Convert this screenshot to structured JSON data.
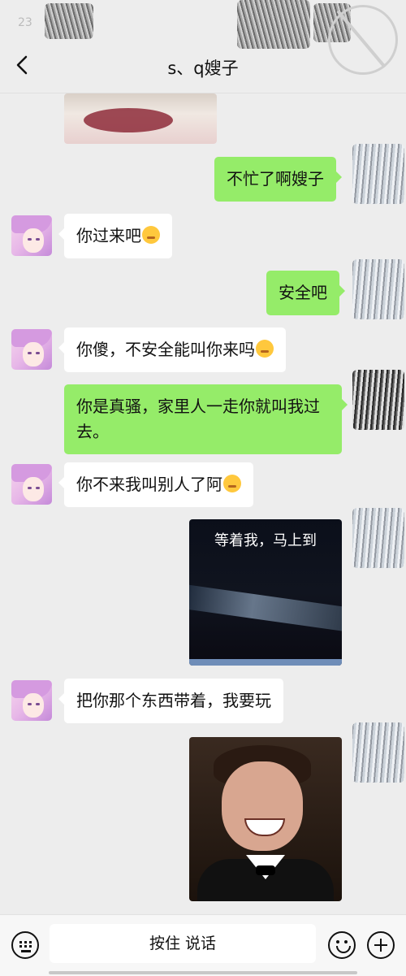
{
  "status": {
    "time": "23"
  },
  "header": {
    "title": "s、q嫂子",
    "back_icon": "chevron-left-icon"
  },
  "messages": [
    {
      "side": "out",
      "text": "不忙了啊嫂子"
    },
    {
      "side": "in",
      "text": "你过来吧"
    },
    {
      "side": "out",
      "text": "安全吧"
    },
    {
      "side": "in",
      "text": "你傻，不安全能叫你来吗"
    },
    {
      "side": "out",
      "text": "你是真骚，家里人一走你就叫我过去。"
    },
    {
      "side": "in",
      "text": "你不来我叫别人了阿"
    },
    {
      "side": "out",
      "type": "image",
      "caption": "等着我，马上到"
    },
    {
      "side": "in",
      "text": "把你那个东西带着，我要玩"
    },
    {
      "side": "out",
      "type": "image"
    }
  ],
  "input_bar": {
    "hold_to_talk": "按住 说话",
    "keyboard_icon": "keyboard-icon",
    "emoji_icon": "emoji-icon",
    "plus_icon": "plus-icon"
  },
  "colors": {
    "background": "#ededed",
    "outgoing_bubble": "#95ec69",
    "incoming_bubble": "#ffffff"
  }
}
